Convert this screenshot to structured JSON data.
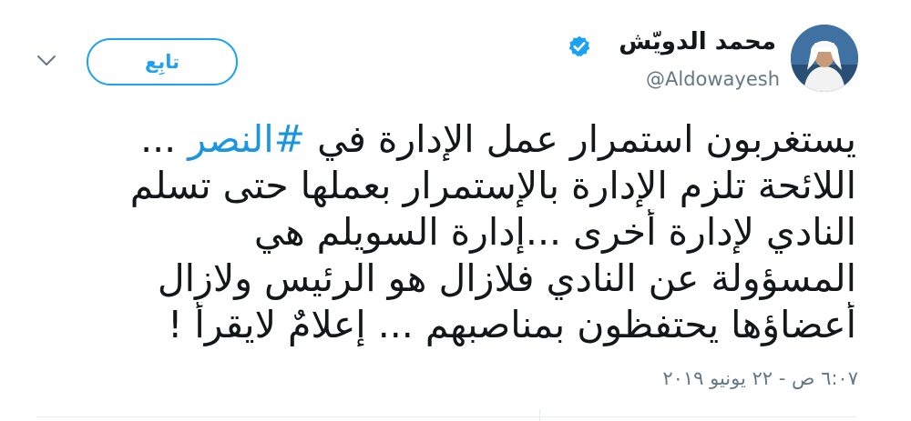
{
  "author": {
    "name": "محمد الدويّش",
    "handle": "@Aldowayesh",
    "verified": true
  },
  "follow_button": {
    "label": "تابِع"
  },
  "menu": {
    "icon": "chevron-down-icon"
  },
  "tweet": {
    "line1_before": "يستغربون استمرار عمل الإدارة في ",
    "hashtag": "#النصر",
    "line1_after": " ...",
    "line2": "اللائحة تلزم الإدارة بالإستمرار بعملها حتى تسلم",
    "line3": "النادي  لإدارة أخرى ...إدارة السويلم هي",
    "line4": "المسؤولة عن النادي فلازال هو الرئيس ولازال",
    "line5": "أعضاؤها يحتفظون بمناصبهم ... إعلامٌ لايقرأ !"
  },
  "timestamp": "٦:٠٧ ص - ٢٢ يونيو ٢٠١٩",
  "colors": {
    "accent": "#1da1f2",
    "hashtag": "#1b95e0",
    "text": "#14171a",
    "secondary": "#657786",
    "divider": "#e6ecf0"
  }
}
